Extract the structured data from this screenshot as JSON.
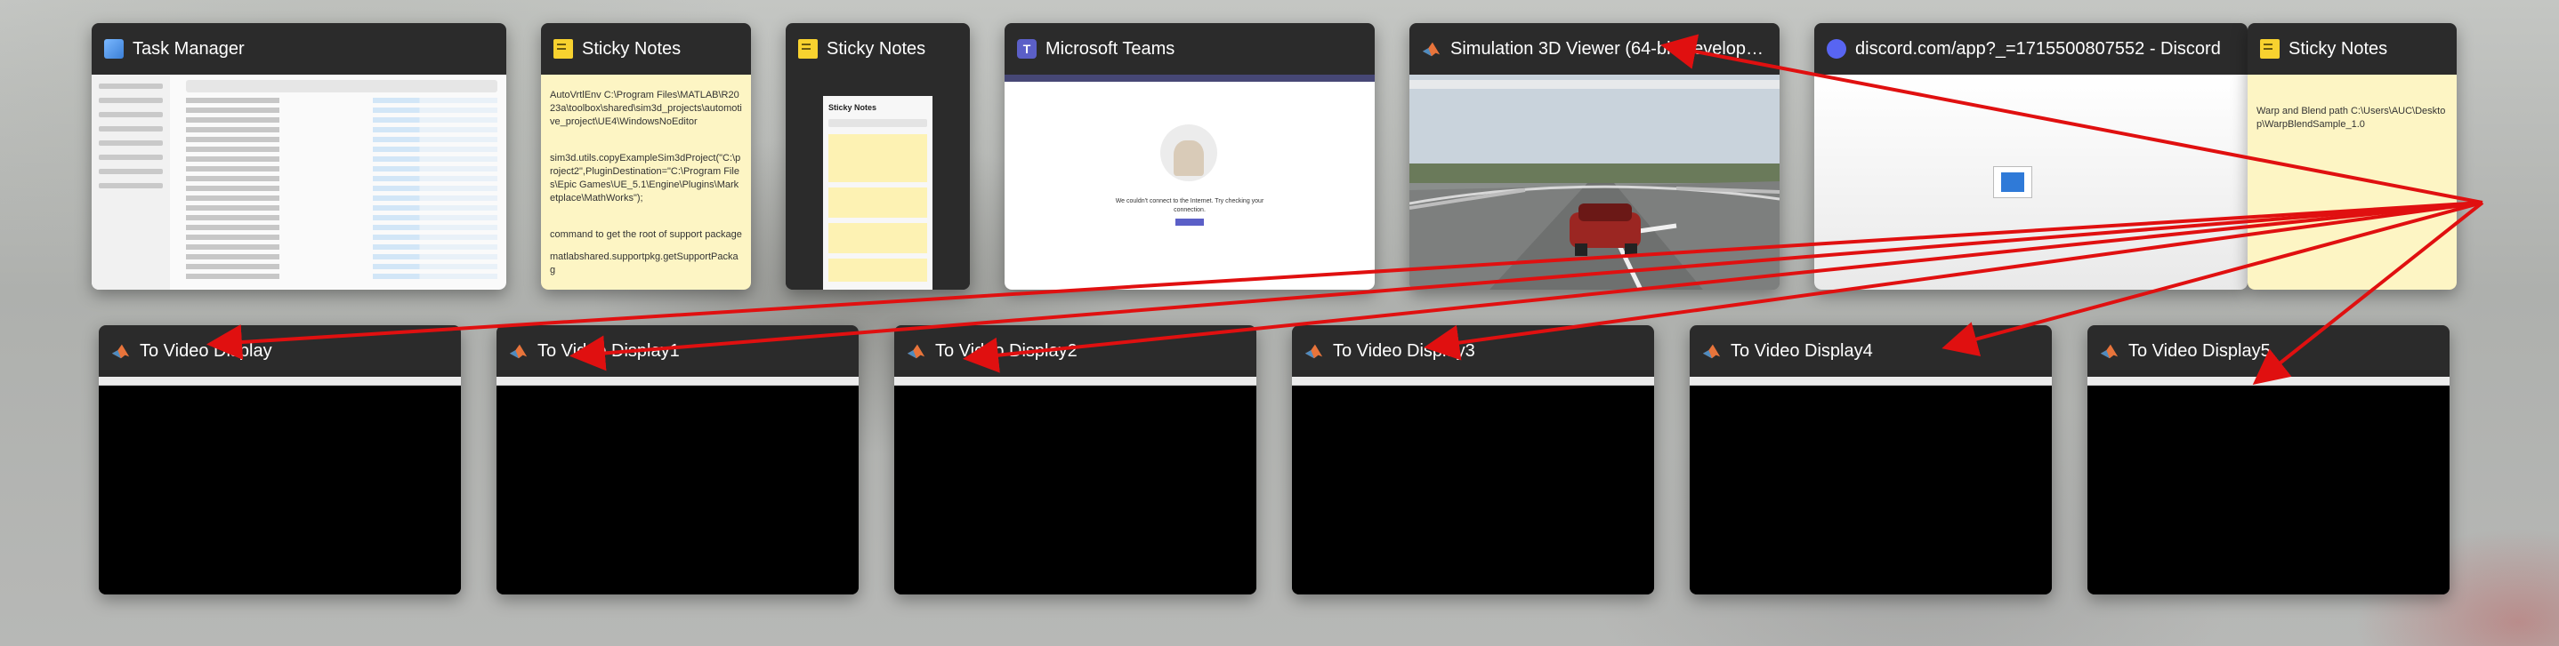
{
  "windows_top": [
    {
      "title": "Task Manager",
      "icon": "task-manager-icon"
    },
    {
      "title": "Sticky Notes",
      "icon": "sticky-notes-icon",
      "note_lines": [
        "AutoVrtlEnv C:\\Program Files\\MATLAB\\R2023a\\toolbox\\shared\\sim3d_projects\\automotive_project\\UE4\\WindowsNoEditor",
        "sim3d.utils.copyExampleSim3dProject(\"C:\\project2\",PluginDestination=\"C:\\Program Files\\Epic Games\\UE_5.1\\Engine\\Plugins\\Marketplace\\MathWorks\");",
        "command to get the root of support package",
        "matlabshared.supportpkg.getSupportPackag"
      ]
    },
    {
      "title": "Sticky Notes",
      "icon": "sticky-notes-icon",
      "panel_title": "Sticky Notes"
    },
    {
      "title": "Microsoft Teams",
      "icon": "teams-icon",
      "message": "We couldn't connect to the Internet. Try checking your connection."
    },
    {
      "title": "Simulation 3D Viewer (64-bit Developme...",
      "icon": "matlab-icon"
    },
    {
      "title": "discord.com/app?_=1715500807552 - Discord",
      "icon": "discord-icon"
    },
    {
      "title": "Sticky Notes",
      "icon": "sticky-notes-icon",
      "note_lines": [
        "Warp and Blend path C:\\Users\\AUC\\Desktop\\WarpBlendSample_1.0"
      ]
    }
  ],
  "windows_bottom": [
    {
      "title": "To Video Display",
      "icon": "matlab-icon"
    },
    {
      "title": "To Video Display1",
      "icon": "matlab-icon"
    },
    {
      "title": "To Video Display2",
      "icon": "matlab-icon"
    },
    {
      "title": "To Video Display3",
      "icon": "matlab-icon"
    },
    {
      "title": "To Video Display4",
      "icon": "matlab-icon"
    },
    {
      "title": "To Video Display5",
      "icon": "matlab-icon"
    }
  ],
  "colors": {
    "arrow": "#e01010",
    "sticky": "#fdf5c4",
    "titlebar": "#2b2b2b"
  }
}
